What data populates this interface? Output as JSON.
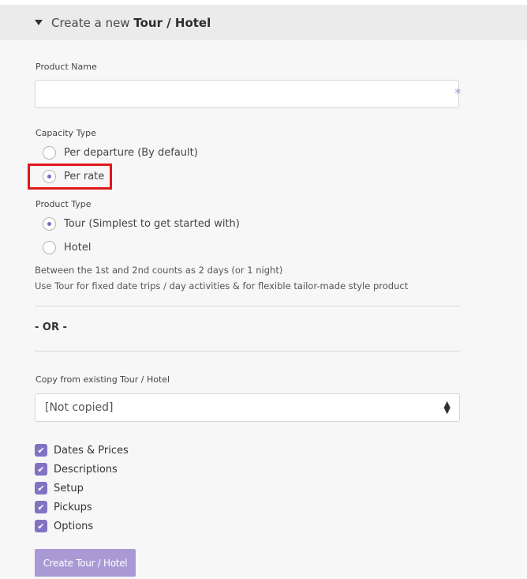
{
  "header": {
    "title_prefix": "Create a new",
    "title_bold": "Tour / Hotel"
  },
  "product_name": {
    "label": "Product Name",
    "value": "",
    "placeholder": "",
    "required_mark": "*"
  },
  "capacity_type": {
    "label": "Capacity Type",
    "options": [
      {
        "label": "Per departure (By default)",
        "selected": false
      },
      {
        "label": "Per rate",
        "selected": true
      }
    ]
  },
  "product_type": {
    "label": "Product Type",
    "options": [
      {
        "label": "Tour (Simplest to get started with)",
        "selected": true
      },
      {
        "label": "Hotel",
        "selected": false
      }
    ],
    "help_lines": [
      "Between the 1st and 2nd counts as 2 days (or 1 night)",
      "Use Tour for fixed date trips / day activities & for flexible tailor-made style product"
    ]
  },
  "or_text": "- OR -",
  "copy_from": {
    "label": "Copy from existing Tour / Hotel",
    "selected_value": "[Not copied]"
  },
  "copy_options": [
    {
      "label": "Dates & Prices",
      "checked": true
    },
    {
      "label": "Descriptions",
      "checked": true
    },
    {
      "label": "Setup",
      "checked": true
    },
    {
      "label": "Pickups",
      "checked": true
    },
    {
      "label": "Options",
      "checked": true
    }
  ],
  "create_button_label": "Create Tour / Hotel",
  "colors": {
    "accent": "#8272c2",
    "button": "#a99ad6",
    "highlight": "#e0171c"
  }
}
